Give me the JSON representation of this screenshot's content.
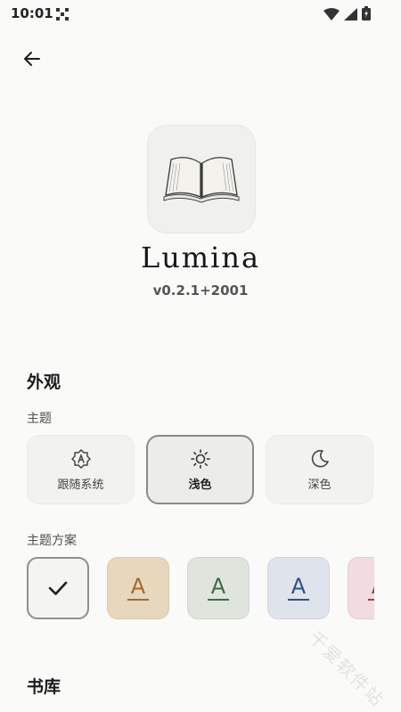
{
  "status_bar": {
    "time": "10:01",
    "icons": [
      "qr-grid-icon",
      "wifi-icon",
      "signal-icon",
      "battery-icon"
    ]
  },
  "header": {
    "back_icon": "arrow-left-icon"
  },
  "app": {
    "name": "Lumina",
    "version": "v0.2.1+2001",
    "icon": "open-book-icon"
  },
  "appearance": {
    "title": "外观",
    "theme": {
      "label": "主题",
      "options": [
        {
          "label": "跟随系统",
          "icon": "auto-brightness-icon",
          "selected": false
        },
        {
          "label": "浅色",
          "icon": "sun-icon",
          "selected": true
        },
        {
          "label": "深色",
          "icon": "moon-icon",
          "selected": false
        }
      ]
    },
    "scheme": {
      "label": "主题方案",
      "options": [
        {
          "selected": true,
          "background": "#f4f4f2",
          "accent": "#1f1f1f"
        },
        {
          "letter": "A",
          "background": "#e7d7bd",
          "accent": "#a1692e"
        },
        {
          "letter": "A",
          "background": "#dfe5dd",
          "accent": "#3e6a45"
        },
        {
          "letter": "A",
          "background": "#dfe3ec",
          "accent": "#2d5189"
        },
        {
          "letter": "A",
          "background": "#f1dcdf",
          "accent": "#a3404c"
        }
      ]
    }
  },
  "library": {
    "title": "书库"
  },
  "watermark": "千爱软件站"
}
